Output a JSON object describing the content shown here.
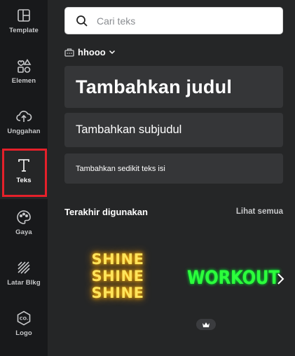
{
  "sidebar": {
    "items": [
      {
        "label": "Template",
        "icon": "template-icon"
      },
      {
        "label": "Elemen",
        "icon": "elements-icon"
      },
      {
        "label": "Unggahan",
        "icon": "upload-icon"
      },
      {
        "label": "Teks",
        "icon": "text-icon",
        "active": true
      },
      {
        "label": "Gaya",
        "icon": "palette-icon"
      },
      {
        "label": "Latar Blkg",
        "icon": "background-icon"
      },
      {
        "label": "Logo",
        "icon": "logo-icon"
      }
    ],
    "highlight_color": "#e5202a"
  },
  "search": {
    "placeholder": "Cari teks",
    "value": ""
  },
  "brand_kit": {
    "name": "hhooo",
    "icon": "brand-kit-icon"
  },
  "text_styles": {
    "heading": "Tambahkan judul",
    "subheading": "Tambahkan subjudul",
    "body": "Tambahkan sedikit teks isi"
  },
  "recent": {
    "title": "Terakhir digunakan",
    "see_all": "Lihat semua",
    "items": [
      {
        "lines": [
          "SHINE",
          "SHINE",
          "SHINE"
        ],
        "color": "#ffe45a",
        "premium": true,
        "badge_icon": "crown-icon"
      },
      {
        "text": "WORKOUT",
        "color": "#2cff3c"
      }
    ]
  },
  "colors": {
    "rail_bg": "#18191b",
    "panel_bg": "#252627",
    "card_bg": "#353638"
  }
}
